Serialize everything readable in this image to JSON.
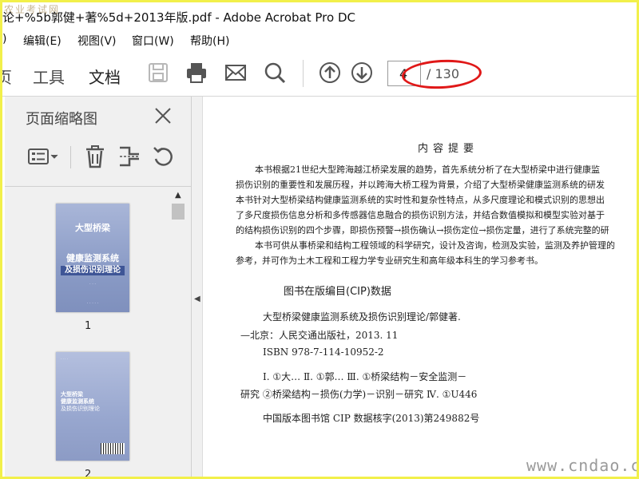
{
  "titlebar": {
    "title": "论+%5b郭健+著%5d+2013年版.pdf - Adobe Acrobat Pro DC",
    "watermark": "农业考试网"
  },
  "menubar": {
    "items": [
      ")",
      "编辑(E)",
      "视图(V)",
      "窗口(W)",
      "帮助(H)"
    ]
  },
  "toolbar": {
    "tab_left_partial": "页",
    "tab_tools": "工具",
    "tab_document": "文档",
    "page_current": "4",
    "page_total": "/ 130",
    "icons": [
      "save-icon",
      "print-icon",
      "email-icon",
      "search-icon",
      "page-up-icon",
      "page-down-icon"
    ]
  },
  "sidebar": {
    "title": "页面缩略图",
    "thumbnails": [
      {
        "label": "1",
        "title_line1": "大型桥梁",
        "title_line2": "健康监测系统",
        "title_line3": "及损伤识别理论"
      },
      {
        "label": "2",
        "title_line1": "大型桥梁",
        "title_line2": "健康监测系统",
        "title_line3": "及损伤识别理论"
      }
    ]
  },
  "document": {
    "heading": "内容提要",
    "paragraph1": [
      "本书根据21世纪大型跨海越江桥梁发展的趋势，首先系统分析了在大型桥梁中进行健康监",
      "损伤识别的重要性和发展历程，并以跨海大桥工程为背景，介绍了大型桥梁健康监测系统的研发",
      "本书针对大型桥梁结构健康监测系统的实时性和复杂性特点，从多尺度理论和模式识别的思想出",
      "了多尺度损伤信息分析和多传感器信息融合的损伤识别方法，并结合数值模拟和模型实验对基于",
      "的结构损伤识别的四个步骤，即损伤预警→损伤确认→损伤定位→损伤定量，进行了系统完整的研"
    ],
    "paragraph2": [
      "本书可供从事桥梁和结构工程领域的科学研究，设计及咨询，检测及实验，监测及养护管理的",
      "参考，并可作为土木工程和工程力学专业研究生和高年级本科生的学习参考书。"
    ],
    "cip_title": "图书在版编目(CIP)数据",
    "cip_lines": [
      "大型桥梁健康监测系统及损伤识别理论/郭健著.",
      "—北京：人民交通出版社，2013. 11",
      "ISBN  978-7-114-10952-2",
      "Ⅰ. ①大…   Ⅱ. ①郭…   Ⅲ. ①桥梁结构－安全监测－",
      "研究   ②桥梁结构－损伤(力学)－识别－研究   Ⅳ. ①U446",
      "中国版本图书馆 CIP 数据核字(2013)第249882号"
    ]
  },
  "watermark_br": "www.cndao.com"
}
